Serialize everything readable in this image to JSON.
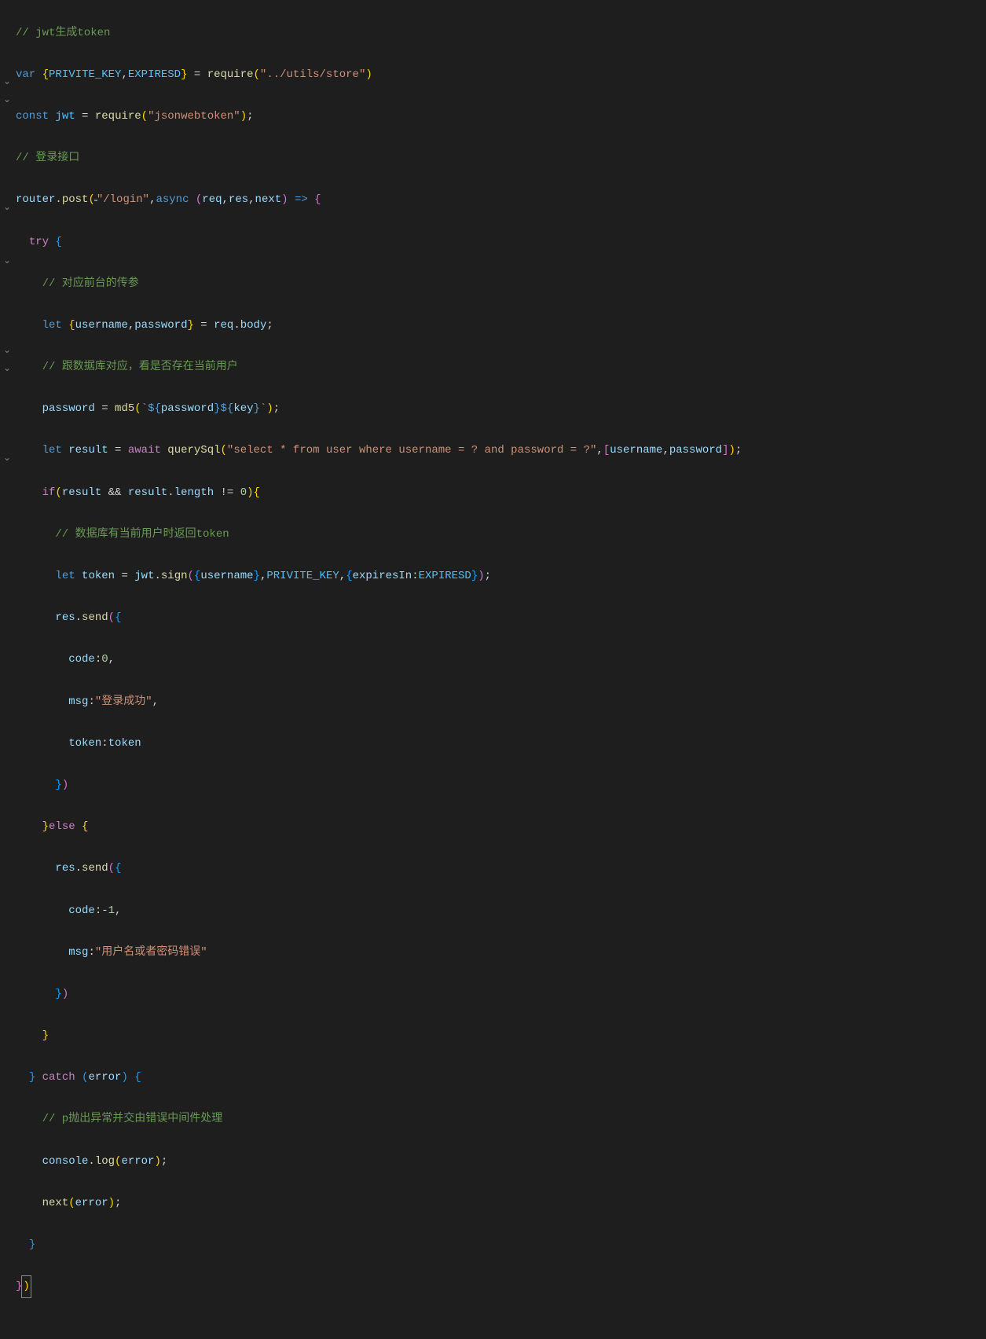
{
  "folds": [
    "",
    "",
    "",
    "",
    "⌄",
    "⌄",
    "",
    "",
    "",
    "",
    "",
    "⌄",
    "",
    "",
    "⌄",
    "",
    "",
    "",
    "",
    "⌄",
    "⌄",
    "",
    "",
    "",
    "",
    "⌄",
    "",
    "",
    "",
    "",
    ""
  ],
  "code": {
    "c1": "// jwt生成token",
    "l2": {
      "var": "var",
      "lb": "{",
      "k1": "PRIVITE_KEY",
      "comma": ",",
      "k2": "EXPIRESD",
      "rb": "}",
      "eq": " = ",
      "fn": "require",
      "lp": "(",
      "str": "\"../utils/store\"",
      "rp": ")"
    },
    "l3": {
      "const": "const",
      "name": "jwt",
      "eq": " = ",
      "fn": "require",
      "lp": "(",
      "str": "\"jsonwebtoken\"",
      "rp": ")",
      "semi": ";"
    },
    "c4": "// 登录接口",
    "l5": {
      "obj": "router",
      "dot": ".",
      "fn": "post",
      "lp": "(",
      "str": "\"/login\"",
      "comma": ",",
      "async": "async",
      "lp2": "(",
      "a1": "req",
      "a2": "res",
      "a3": "next",
      "rp2": ")",
      "arrow": " => ",
      "lb": "{"
    },
    "l6": {
      "try": "try",
      "lb": " {"
    },
    "c7": "    // 对应前台的传参",
    "l8": {
      "let": "let",
      "lb": "{",
      "v1": "username",
      "comma": ",",
      "v2": "password",
      "rb": "}",
      "eq": " = ",
      "obj": "req",
      "dot": ".",
      "prop": "body",
      "semi": ";"
    },
    "c9": "    // 跟数据库对应，看是否存在当前用户",
    "l10": {
      "v": "password",
      "eq": " = ",
      "fn": "md5",
      "lp": "(",
      "bt1": "`",
      "d1": "${",
      "v1": "password",
      "rb1": "}",
      "d2": "${",
      "v2": "key",
      "rb2": "}",
      "bt2": "`",
      "rp": ")",
      "semi": ";"
    },
    "l11": {
      "let": "let",
      "v": "result",
      "eq": " = ",
      "await": "await",
      "fn": "querySql",
      "lp": "(",
      "str": "\"select * from user where username = ? and password = ?\"",
      "comma": ",",
      "lb": "[",
      "v1": "username",
      "c2": ",",
      "v2": "password",
      "rb": "]",
      "rp": ")",
      "semi": ";"
    },
    "l12": {
      "if": "if",
      "lp": "(",
      "v1": "result",
      "and": " && ",
      "v2": "result",
      "dot": ".",
      "prop": "length",
      "neq": " != ",
      "num": "0",
      "rp": ")",
      "lb": "{"
    },
    "c13": "      // 数据库有当前用户时返回token",
    "l14": {
      "let": "let",
      "v": "token",
      "eq": " = ",
      "obj": "jwt",
      "dot": ".",
      "fn": "sign",
      "lp": "(",
      "lb": "{",
      "p1": "username",
      "rb": "}",
      "c1": ",",
      "k1": "PRIVITE_KEY",
      "c2": ",",
      "lb2": "{",
      "p2": "expiresIn",
      "colon": ":",
      "k2": "EXPIRESD",
      "rb2": "}",
      "rp": ")",
      "semi": ";"
    },
    "l15": {
      "obj": "res",
      "dot": ".",
      "fn": "send",
      "lp": "(",
      "lb": "{"
    },
    "l16": {
      "k": "code",
      "colon": ":",
      "num": "0",
      "comma": ","
    },
    "l17": {
      "k": "msg",
      "colon": ":",
      "str": "\"登录成功\"",
      "comma": ","
    },
    "l18": {
      "k": "token",
      "colon": ":",
      "v": "token"
    },
    "l19": {
      "rb": "}",
      "rp": ")"
    },
    "l20": {
      "rb": "}",
      "else": "else",
      "lb": " {"
    },
    "l21": {
      "obj": "res",
      "dot": ".",
      "fn": "send",
      "lp": "(",
      "lb": "{"
    },
    "l22": {
      "k": "code",
      "colon": ":",
      "neg": "-",
      "num": "1",
      "comma": ","
    },
    "l23": {
      "k": "msg",
      "colon": ":",
      "str": "\"用户名或者密码错误\""
    },
    "l24": {
      "rb": "}",
      "rp": ")"
    },
    "l25": {
      "rb": "}"
    },
    "l26": {
      "rb": "}",
      "catch": " catch ",
      "lp": "(",
      "v": "error",
      "rp": ")",
      "lb": " {"
    },
    "c27": "    // p抛出异常并交由错误中间件处理",
    "l28": {
      "obj": "console",
      "dot": ".",
      "fn": "log",
      "lp": "(",
      "v": "error",
      "rp": ")",
      "semi": ";"
    },
    "l29": {
      "fn": "next",
      "lp": "(",
      "v": "error",
      "rp": ")",
      "semi": ";"
    },
    "l30": {
      "rb": "}"
    },
    "l31": {
      "rb": "}",
      "rp": ")"
    }
  }
}
